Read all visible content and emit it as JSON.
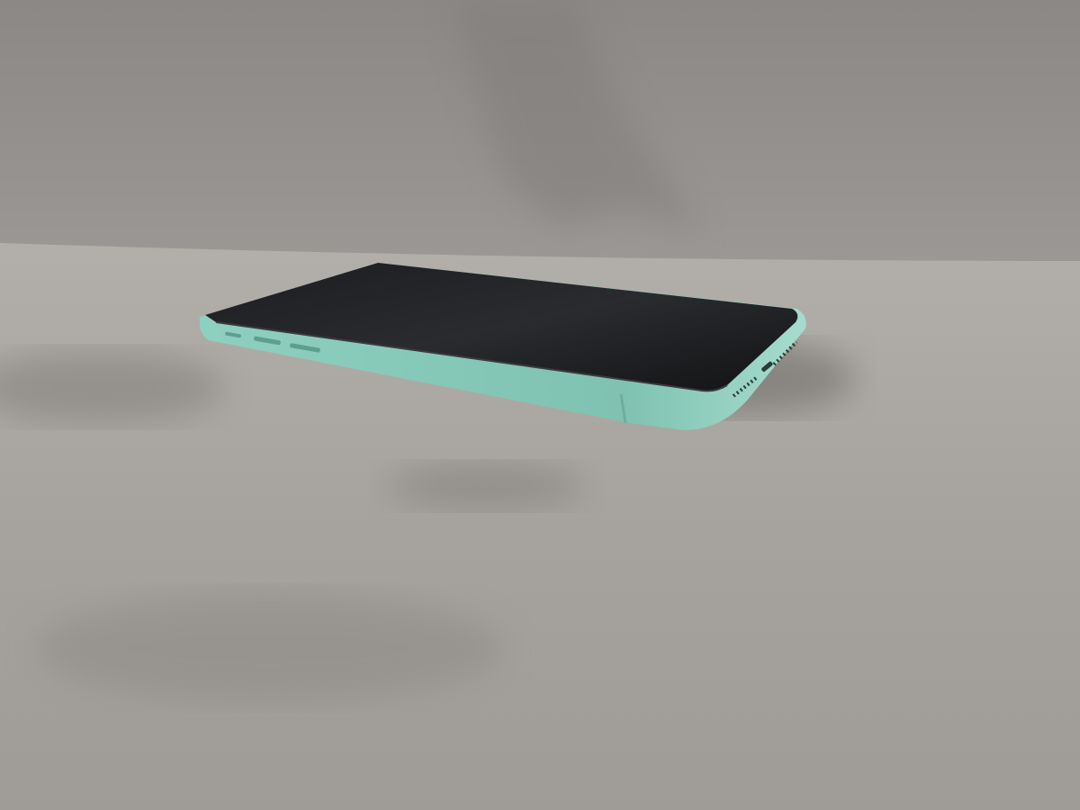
{
  "scene": {
    "subject": "smartphone",
    "colors": {
      "backrest": "#8e8b88",
      "seat": "#a9a6a2",
      "seat_shadow": "#7d7a77",
      "phone_frame": "#8fd1c0",
      "phone_frame_dark": "#5f9e8f",
      "screen": "#151618"
    }
  }
}
